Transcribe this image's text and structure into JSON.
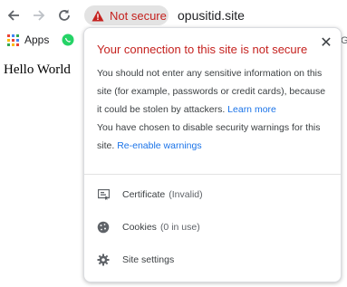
{
  "omnibox": {
    "security_chip": "Not secure",
    "url": "opusitid.site"
  },
  "bookmarks": {
    "apps_label": "Apps",
    "overflow_glyph": "G"
  },
  "page": {
    "body_text": "Hello World"
  },
  "popup": {
    "title": "Your connection to this site is not secure",
    "close_glyph": "✕",
    "warning_text": "You should not enter any sensitive information on this site (for example, passwords or credit cards), because it could be stolen by attackers.",
    "learn_more": "Learn more",
    "disabled_text": "You have chosen to disable security warnings for this site.",
    "reenable": "Re-enable warnings",
    "items": [
      {
        "label": "Certificate",
        "sub": "(Invalid)",
        "icon": "certificate-icon"
      },
      {
        "label": "Cookies",
        "sub": "(0 in use)",
        "icon": "cookie-icon"
      },
      {
        "label": "Site settings",
        "sub": "",
        "icon": "gear-icon"
      }
    ]
  },
  "colors": {
    "danger": "#c5221f",
    "link": "#1a73e8",
    "text": "#3c4043"
  }
}
